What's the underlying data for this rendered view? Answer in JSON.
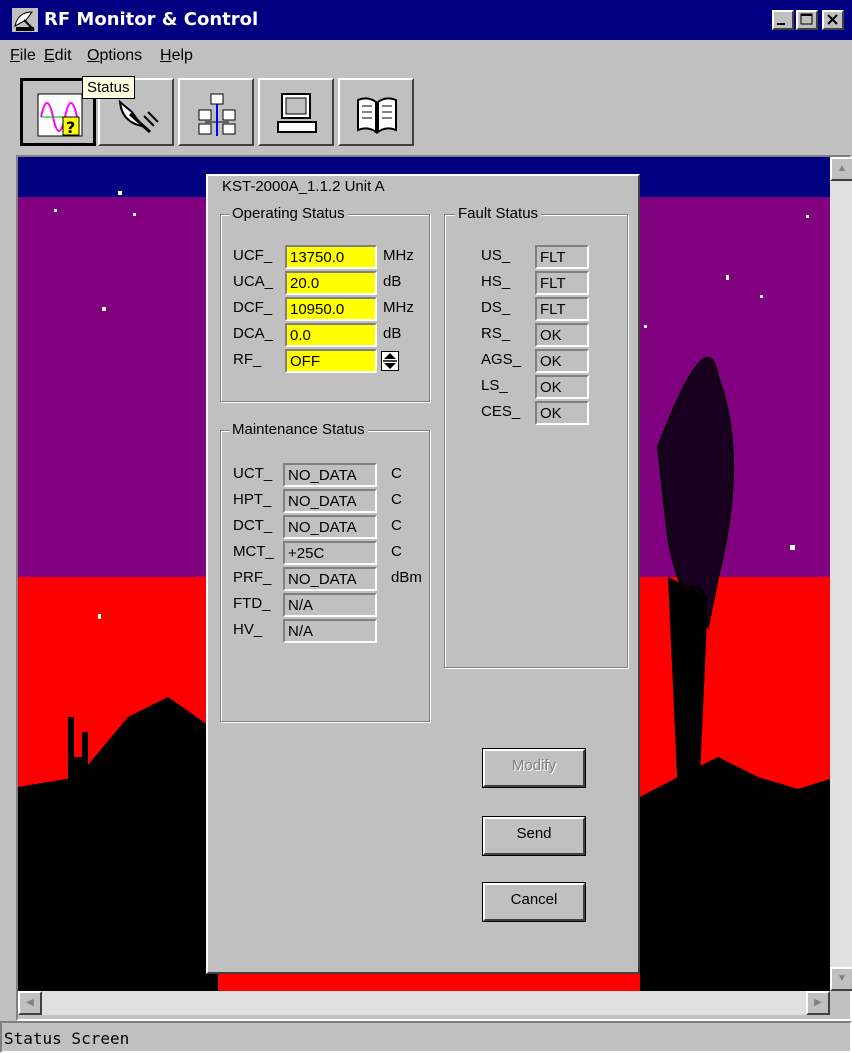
{
  "window": {
    "title": "RF Monitor & Control"
  },
  "menu": [
    {
      "label": "File",
      "accel": "F",
      "rest": "ile"
    },
    {
      "label": "Edit",
      "accel": "E",
      "rest": "dit"
    },
    {
      "label": "Options",
      "accel": "O",
      "rest": "ptions"
    },
    {
      "label": "Help",
      "accel": "H",
      "rest": "elp"
    }
  ],
  "toolbar": {
    "tooltip": "Status",
    "tools": [
      "status-icon",
      "satellite-dish-icon",
      "network-icon",
      "computer-icon",
      "book-icon"
    ]
  },
  "dialog": {
    "title": "KST-2000A_1.1.2 Unit A",
    "operating": {
      "label": "Operating Status",
      "rows": [
        {
          "label": "UCF_",
          "value": "13750.0",
          "unit": "MHz"
        },
        {
          "label": "UCA_",
          "value": "20.0",
          "unit": "dB"
        },
        {
          "label": "DCF_",
          "value": "10950.0",
          "unit": "MHz"
        },
        {
          "label": "DCA_",
          "value": "0.0",
          "unit": "dB"
        },
        {
          "label": "RF_",
          "value": "OFF",
          "unit": ""
        }
      ]
    },
    "maintenance": {
      "label": "Maintenance Status",
      "rows": [
        {
          "label": "UCT_",
          "value": "NO_DATA",
          "unit": "C"
        },
        {
          "label": "HPT_",
          "value": "NO_DATA",
          "unit": "C"
        },
        {
          "label": "DCT_",
          "value": "NO_DATA",
          "unit": "C"
        },
        {
          "label": "MCT_",
          "value": "+25C",
          "unit": "C"
        },
        {
          "label": "PRF_",
          "value": "NO_DATA",
          "unit": "dBm"
        },
        {
          "label": "FTD_",
          "value": "N/A",
          "unit": ""
        },
        {
          "label": "HV_",
          "value": "N/A",
          "unit": ""
        }
      ]
    },
    "fault": {
      "label": "Fault Status",
      "rows": [
        {
          "label": "US_",
          "value": "FLT"
        },
        {
          "label": "HS_",
          "value": "FLT"
        },
        {
          "label": "DS_",
          "value": "FLT"
        },
        {
          "label": "RS_",
          "value": "OK"
        },
        {
          "label": "AGS_",
          "value": "OK"
        },
        {
          "label": "LS_",
          "value": "OK"
        },
        {
          "label": "CES_",
          "value": "OK"
        }
      ]
    },
    "buttons": {
      "modify": "Modify",
      "send": "Send",
      "cancel": "Cancel"
    }
  },
  "statusbar": {
    "text": "Status Screen"
  },
  "colors": {
    "titlebar": "#000080",
    "sky": "#800080",
    "ground": "#ff0000",
    "input_active": "#ffff00"
  }
}
